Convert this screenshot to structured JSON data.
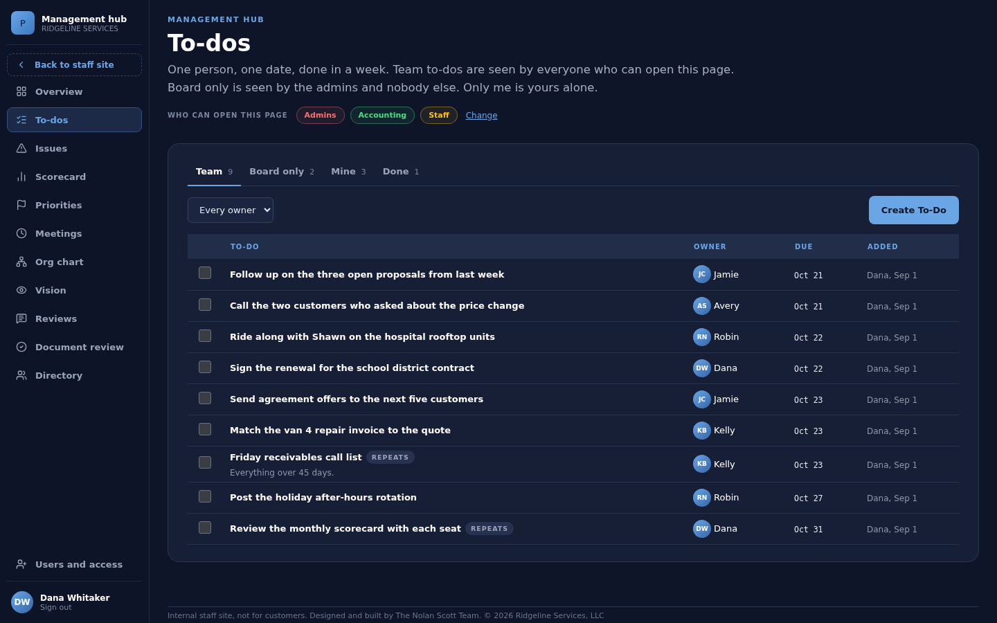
{
  "brand": {
    "logo": "P",
    "title": "Management hub",
    "subtitle": "RIDGELINE SERVICES"
  },
  "back_link": "Back to staff site",
  "nav": [
    {
      "label": "Overview",
      "selected": false
    },
    {
      "label": "To-dos",
      "selected": true
    },
    {
      "label": "Issues",
      "selected": false
    },
    {
      "label": "Scorecard",
      "selected": false
    },
    {
      "label": "Priorities",
      "selected": false
    },
    {
      "label": "Meetings",
      "selected": false
    },
    {
      "label": "Org chart",
      "selected": false
    },
    {
      "label": "Vision",
      "selected": false
    },
    {
      "label": "Reviews",
      "selected": false
    },
    {
      "label": "Document review",
      "selected": false
    },
    {
      "label": "Directory",
      "selected": false
    }
  ],
  "bottom_nav": {
    "label": "Users and access"
  },
  "user": {
    "initials": "DW",
    "name": "Dana Whitaker",
    "action": "Sign out"
  },
  "eyebrow": "MANAGEMENT HUB",
  "title": "To-dos",
  "description": [
    "One person, one date, done in a week. Team to-dos are seen by everyone who can open this page.",
    "Board only is seen by the admins and nobody else. Only me is yours alone."
  ],
  "access": {
    "label": "WHO CAN OPEN THIS PAGE",
    "groups": [
      {
        "name": "Admins",
        "color": "#f87171"
      },
      {
        "name": "Accounting",
        "color": "#4ade80"
      },
      {
        "name": "Staff",
        "color": "#fbbf24"
      }
    ],
    "link": "Change"
  },
  "tabs": [
    {
      "label": "Team",
      "count": "9",
      "selected": true
    },
    {
      "label": "Board only",
      "count": "2",
      "selected": false
    },
    {
      "label": "Mine",
      "count": "3",
      "selected": false
    },
    {
      "label": "Done",
      "count": "1",
      "selected": false
    }
  ],
  "owner_filter": "Every owner",
  "create_button": "Create To-Do",
  "table": {
    "columns": [
      "TO-DO",
      "OWNER",
      "DUE",
      "ADDED"
    ],
    "rows": [
      {
        "checked": false,
        "title": "Follow up on the three open proposals from last week",
        "owner_initials": "JC",
        "owner": "Jamie",
        "due": "Oct 21",
        "added": "Dana, Sep 1"
      },
      {
        "checked": false,
        "title": "Call the two customers who asked about the price change",
        "owner_initials": "AS",
        "owner": "Avery",
        "due": "Oct 21",
        "added": "Dana, Sep 1"
      },
      {
        "checked": false,
        "title": "Ride along with Shawn on the hospital rooftop units",
        "owner_initials": "RN",
        "owner": "Robin",
        "due": "Oct 22",
        "added": "Dana, Sep 1"
      },
      {
        "checked": false,
        "title": "Sign the renewal for the school district contract",
        "owner_initials": "DW",
        "owner": "Dana",
        "due": "Oct 22",
        "added": "Dana, Sep 1"
      },
      {
        "checked": false,
        "title": "Send agreement offers to the next five customers",
        "owner_initials": "JC",
        "owner": "Jamie",
        "due": "Oct 23",
        "added": "Dana, Sep 1"
      },
      {
        "checked": false,
        "title": "Match the van 4 repair invoice to the quote",
        "owner_initials": "KB",
        "owner": "Kelly",
        "due": "Oct 23",
        "added": "Dana, Sep 1"
      },
      {
        "checked": false,
        "title": "Friday receivables call list",
        "badge": "REPEATS",
        "note": "Everything over 45 days.",
        "owner_initials": "KB",
        "owner": "Kelly",
        "due": "Oct 23",
        "added": "Dana, Sep 1"
      },
      {
        "checked": false,
        "title": "Post the holiday after-hours rotation",
        "owner_initials": "RN",
        "owner": "Robin",
        "due": "Oct 27",
        "added": "Dana, Sep 1"
      },
      {
        "checked": false,
        "title": "Review the monthly scorecard with each seat",
        "badge": "REPEATS",
        "owner_initials": "DW",
        "owner": "Dana",
        "due": "Oct 31",
        "added": "Dana, Sep 1"
      }
    ]
  },
  "footer": "Internal staff site, not for customers. Designed and built by The Nolan Scott Team. © 2026 Ridgeline Services, LLC"
}
